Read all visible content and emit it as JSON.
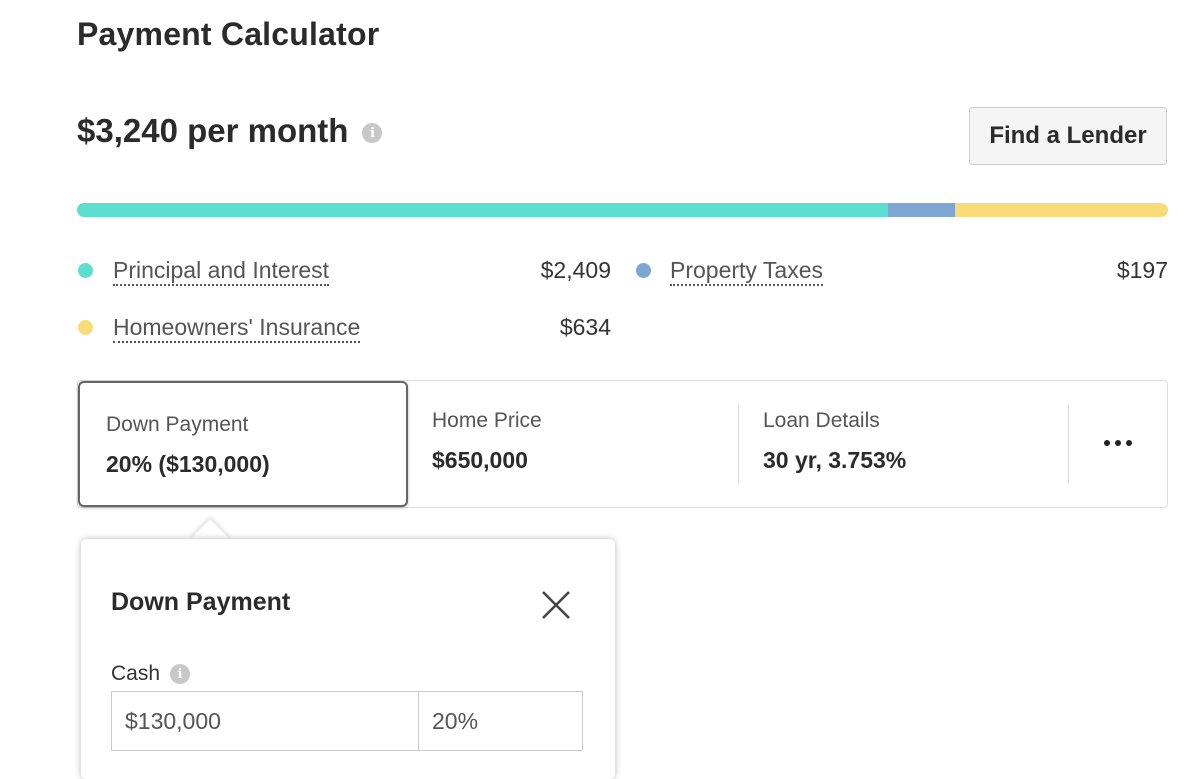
{
  "header": {
    "title": "Payment Calculator"
  },
  "summary": {
    "monthly_payment": "$3,240 per month",
    "find_lender_label": "Find a Lender"
  },
  "breakdown": {
    "bar_colors": {
      "principal": "#5ddfcf",
      "taxes": "#7ea6d2",
      "insurance": "#f8dc7a"
    },
    "bar_shares": {
      "principal": 2409,
      "taxes": 197,
      "insurance": 634
    },
    "items": [
      {
        "label": "Principal and Interest",
        "amount": "$2,409",
        "color": "#5ddfcf"
      },
      {
        "label": "Property Taxes",
        "amount": "$197",
        "color": "#7ea6d2"
      },
      {
        "label": "Homeowners' Insurance",
        "amount": "$634",
        "color": "#f8dc7a"
      }
    ]
  },
  "params": {
    "down_payment": {
      "label": "Down Payment",
      "value": "20% ($130,000)"
    },
    "home_price": {
      "label": "Home Price",
      "value": "$650,000"
    },
    "loan_details": {
      "label": "Loan Details",
      "value": "30 yr, 3.753%"
    },
    "more_icon": "ellipsis-icon"
  },
  "popover": {
    "title": "Down Payment",
    "cash_label": "Cash",
    "cash_value": "$130,000",
    "percent_value": "20%",
    "close_icon": "close-icon"
  }
}
